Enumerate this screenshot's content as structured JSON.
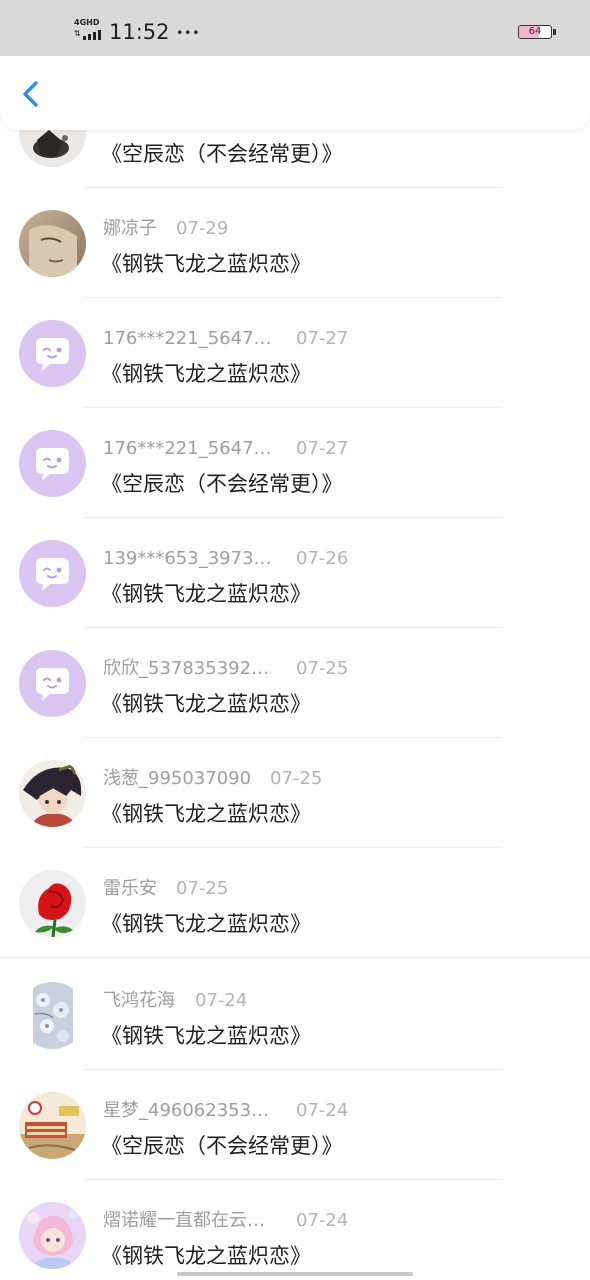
{
  "status_bar": {
    "network": "4GHD",
    "time": "11:52",
    "more_dots": "•••",
    "battery_level": "64",
    "battery_fraction": 0.64
  },
  "header": {
    "back_icon": "chevron-left-icon"
  },
  "items": [
    {
      "username": "",
      "date": "",
      "book": "《空辰恋（不会经常更）》",
      "avatar": "photo-dark-figure"
    },
    {
      "username": "娜凉子",
      "date": "07-29",
      "book": "《钢铁飞龙之蓝炽恋》",
      "avatar": "photo-face"
    },
    {
      "username": "176***221_5647…",
      "date": "07-27",
      "book": "《钢铁飞龙之蓝炽恋》",
      "avatar": "default-chat-bubble"
    },
    {
      "username": "176***221_5647…",
      "date": "07-27",
      "book": "《空辰恋（不会经常更）》",
      "avatar": "default-chat-bubble"
    },
    {
      "username": "139***653_3973…",
      "date": "07-26",
      "book": "《钢铁飞龙之蓝炽恋》",
      "avatar": "default-chat-bubble"
    },
    {
      "username": "欣欣_537835392…",
      "date": "07-25",
      "book": "《钢铁飞龙之蓝炽恋》",
      "avatar": "default-chat-bubble"
    },
    {
      "username": "浅葱_995037090",
      "date": "07-25",
      "book": "《钢铁飞龙之蓝炽恋》",
      "avatar": "anime-character"
    },
    {
      "username": "雷乐安",
      "date": "07-25",
      "book": "《钢铁飞龙之蓝炽恋》",
      "avatar": "red-rose"
    },
    {
      "username": "飞鸿花海",
      "date": "07-24",
      "book": "《钢铁飞龙之蓝炽恋》",
      "avatar": "blue-flowers"
    },
    {
      "username": "星梦_496062353…",
      "date": "07-24",
      "book": "《空辰恋（不会经常更）》",
      "avatar": "cartoon-scene"
    },
    {
      "username": "熠诺耀一直都在云…",
      "date": "07-24",
      "book": "《钢铁飞龙之蓝炽恋》",
      "avatar": "anime-girl"
    }
  ],
  "colors": {
    "accent": "#2f8fe0",
    "default_avatar_bg": "#d9c4f2",
    "username_text": "#9e9e9e",
    "date_text": "#b3b3b3",
    "title_text": "#1f1f1f",
    "status_bar_bg": "#d9d9d9"
  }
}
